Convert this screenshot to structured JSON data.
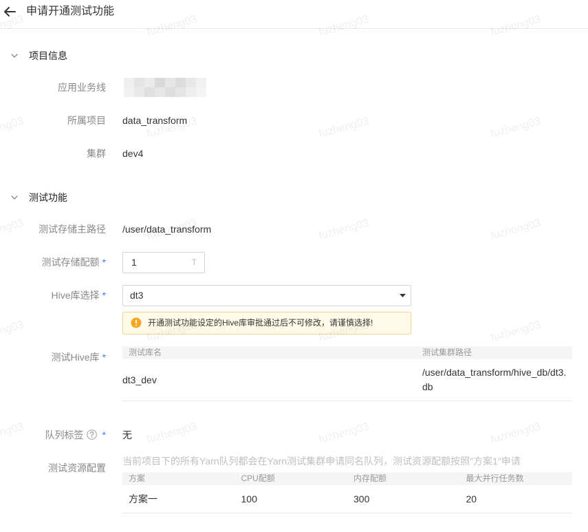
{
  "colors": {
    "accent": "#3a7bfd",
    "warning": "#f5a623"
  },
  "watermark": {
    "text": "fuzheng03"
  },
  "header": {
    "back_icon": "arrow-left-icon",
    "title": "申请开通测试功能"
  },
  "form": {
    "required_mark": "*"
  },
  "project_info": {
    "title": "项目信息",
    "toggle_icon": "chevron-down-icon",
    "business_line": {
      "label": "应用业务线"
    },
    "project": {
      "label": "所属项目",
      "value": "data_transform"
    },
    "cluster": {
      "label": "集群",
      "value": "dev4"
    }
  },
  "test_feature": {
    "title": "测试功能",
    "toggle_icon": "chevron-down-icon",
    "storage_path": {
      "label": "测试存储主路径",
      "value": "/user/data_transform"
    },
    "storage_quota": {
      "label": "测试存储配额",
      "value": "1",
      "unit": "T"
    },
    "hive_select": {
      "label": "Hive库选择",
      "selected": "dt3",
      "caret_icon": "caret-down-icon"
    },
    "hive_warning": {
      "icon": "exclamation-circle-icon",
      "text": "开通测试功能设定的Hive库审批通过后不可修改，请谨慎选择!"
    },
    "test_hive_db": {
      "label": "测试Hive库",
      "columns": [
        "测试库名",
        "测试集群路径"
      ],
      "rows": [
        [
          "dt3_dev",
          "/user/data_transform/hive_db/dt3.db"
        ]
      ]
    },
    "queue_tag": {
      "label": "队列标签",
      "help_icon": "question-circle-icon",
      "value": "无"
    },
    "resource_config": {
      "label": "测试资源配置",
      "description": "当前项目下的所有Yarn队列都会在Yarn测试集群申请同名队列，测试资源配额按照\"方案1\"申请",
      "columns": [
        "方案",
        "CPU配额",
        "内存配额",
        "最大并行任务数"
      ],
      "rows": [
        [
          "方案一",
          "100",
          "300",
          "20"
        ]
      ]
    }
  }
}
